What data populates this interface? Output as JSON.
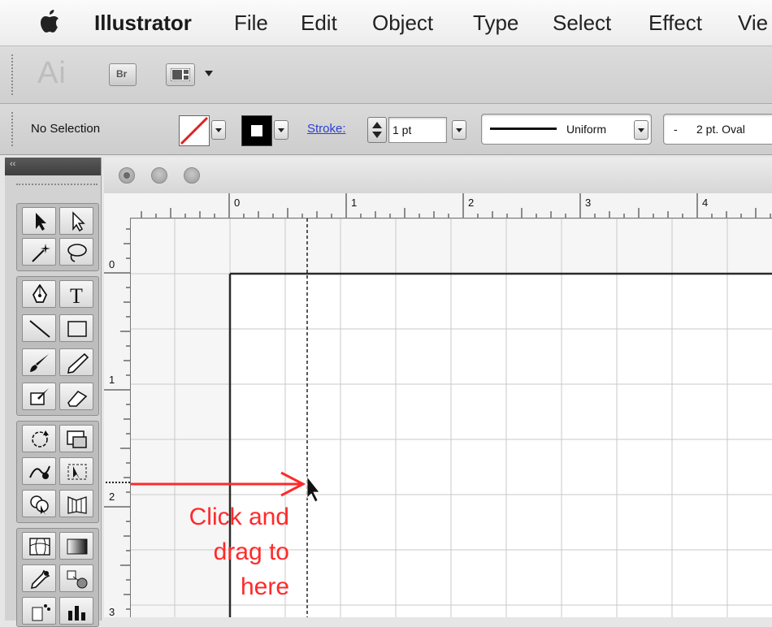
{
  "menubar": {
    "apple_icon": "apple-icon",
    "app_name": "Illustrator",
    "items": [
      "File",
      "Edit",
      "Object",
      "Type",
      "Select",
      "Effect",
      "Vie"
    ]
  },
  "appbar": {
    "ai_logo": "Ai",
    "bridge_label": "Br",
    "arrange_icon": "arrange-documents-icon"
  },
  "controlbar": {
    "selection_status": "No Selection",
    "stroke_label": "Stroke:",
    "stroke_weight": "1 pt",
    "stroke_profile": "Uniform",
    "brush_dash": "-",
    "brush_name": "2 pt. Oval"
  },
  "colors": {
    "annotation": "#ff2a2a",
    "link_blue": "#2a3fd6",
    "grid_line": "#c9c9c9"
  },
  "rulers": {
    "horizontal_labels": [
      "0",
      "1",
      "2",
      "3",
      "4"
    ],
    "vertical_labels": [
      "0",
      "1",
      "2",
      "3"
    ]
  },
  "annotation": {
    "line1": "Click and",
    "line2": "drag to",
    "line3": "here"
  }
}
